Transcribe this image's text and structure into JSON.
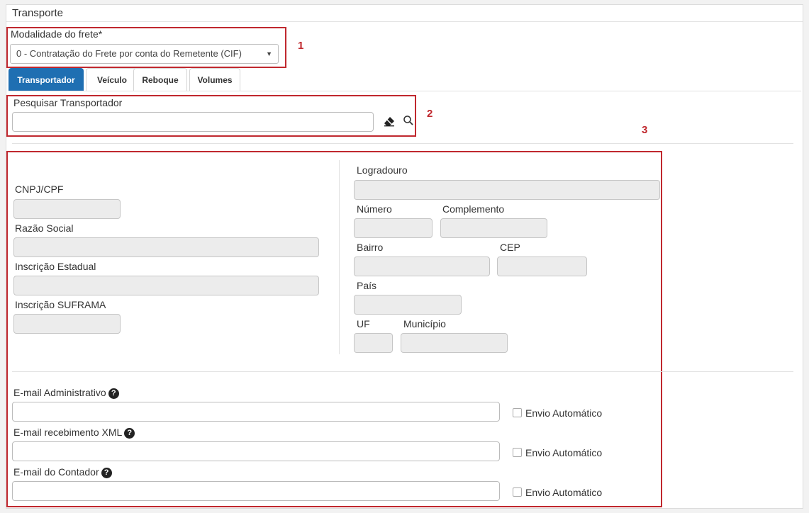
{
  "panel": {
    "title": "Transporte"
  },
  "annotations": [
    "1",
    "2",
    "3"
  ],
  "freight": {
    "label": "Modalidade do frete*",
    "selected": "0 - Contratação do Frete por conta do Remetente (CIF)",
    "arrow": "▼"
  },
  "tabs": [
    "Transportador",
    "Veículo",
    "Reboque",
    "Volumes"
  ],
  "search": {
    "label": "Pesquisar Transportador",
    "value": ""
  },
  "carrier": {
    "cnpj": "CNPJ/CPF",
    "razao": "Razão Social",
    "ie": "Inscrição Estadual",
    "suframa": "Inscrição SUFRAMA",
    "logradouro": "Logradouro",
    "numero": "Número",
    "complemento": "Complemento",
    "bairro": "Bairro",
    "cep": "CEP",
    "pais": "País",
    "uf": "UF",
    "municipio": "Município"
  },
  "emails": [
    {
      "label": "E-mail Administrativo",
      "help": "?",
      "checkbox": "Envio Automático"
    },
    {
      "label": "E-mail recebimento XML",
      "help": "?",
      "checkbox": "Envio Automático"
    },
    {
      "label": "E-mail do Contador",
      "help": "?",
      "checkbox": "Envio Automático"
    }
  ],
  "icons": [
    "eraser-icon",
    "search-icon",
    "question-circle-icon",
    "dropdown-arrow-icon"
  ],
  "colors": {
    "accent": "#1f6fb2",
    "annotation": "#c0282e",
    "readonly": "#ececec"
  }
}
